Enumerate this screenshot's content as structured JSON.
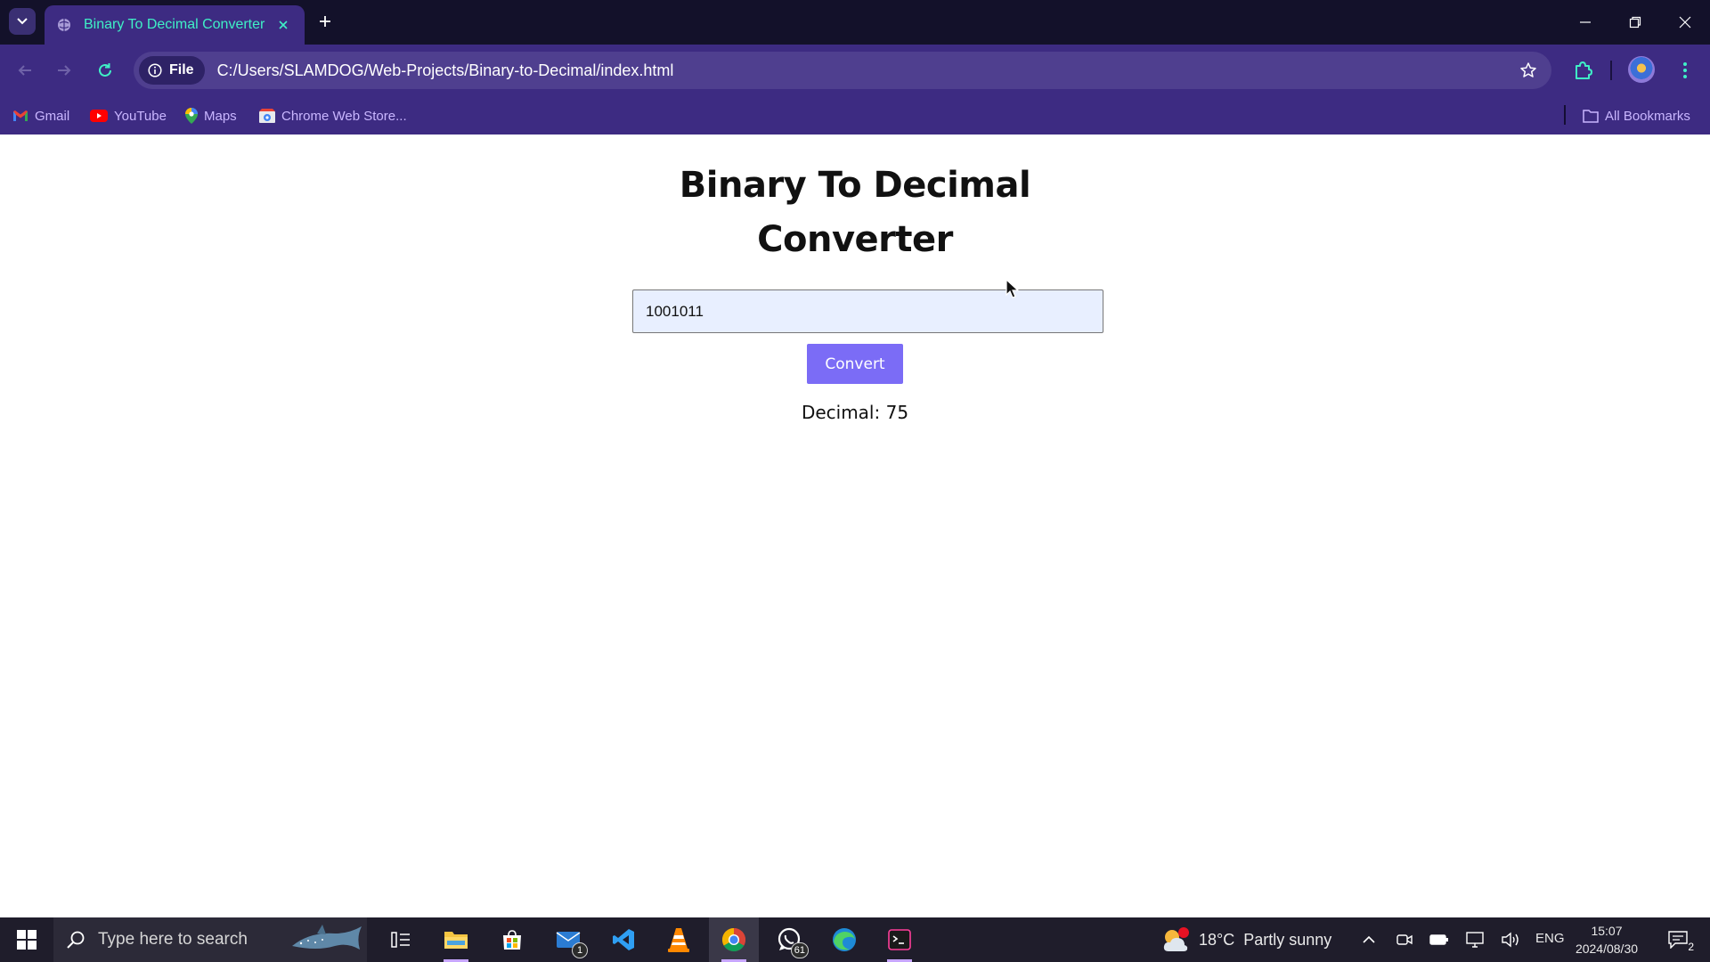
{
  "browser": {
    "tab": {
      "title": "Binary To Decimal Converter"
    },
    "omnibox": {
      "chip_label": "File",
      "url": "C:/Users/SLAMDOG/Web-Projects/Binary-to-Decimal/index.html"
    },
    "bookmarks": [
      {
        "label": "Gmail",
        "icon": "gmail-icon"
      },
      {
        "label": "YouTube",
        "icon": "youtube-icon"
      },
      {
        "label": "Maps",
        "icon": "maps-icon"
      },
      {
        "label": "Chrome Web Store...",
        "icon": "chrome-web-store-icon"
      }
    ],
    "all_bookmarks_label": "All Bookmarks"
  },
  "page": {
    "title": "Binary To Decimal Converter",
    "input_value": "1001011",
    "button_label": "Convert",
    "result_label": "Decimal",
    "result_value": "75",
    "colors": {
      "button": "#7b6cf6",
      "input_bg": "#e8efff"
    }
  },
  "taskbar": {
    "search_placeholder": "Type here to search",
    "mail_badge": "1",
    "whatsapp_badge": "61",
    "weather": {
      "temp": "18°C",
      "condition": "Partly sunny",
      "alert_badge": "1"
    },
    "language": "ENG",
    "time": "15:07",
    "date": "2024/08/30",
    "notification_count": "2"
  }
}
